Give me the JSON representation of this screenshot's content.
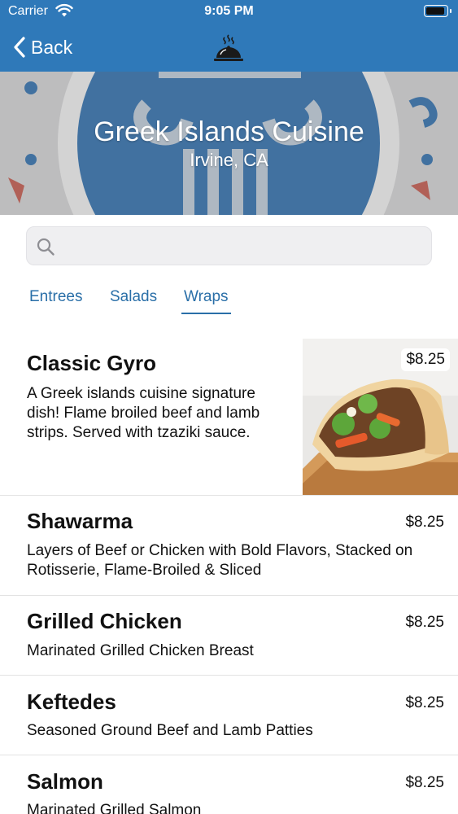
{
  "status_bar": {
    "carrier": "Carrier",
    "time": "9:05 PM",
    "battery_level": 0.95
  },
  "nav": {
    "back_label": "Back",
    "logo_icon": "cloche-icon"
  },
  "hero": {
    "title": "Greek Islands Cuisine",
    "subtitle": "Irvine, CA"
  },
  "search": {
    "placeholder": "",
    "value": ""
  },
  "tabs": [
    {
      "label": "Entrees",
      "active": false
    },
    {
      "label": "Salads",
      "active": false
    },
    {
      "label": "Wraps",
      "active": true
    }
  ],
  "menu_items": [
    {
      "name": "Classic Gyro",
      "description": "A Greek islands cuisine signature dish! Flame broiled beef and lamb strips. Served with tzaziki sauce.",
      "price": "$8.25",
      "has_image": true
    },
    {
      "name": "Shawarma",
      "description": "Layers of Beef or Chicken with Bold Flavors, Stacked on Rotisserie, Flame-Broiled & Sliced",
      "price": "$8.25"
    },
    {
      "name": "Grilled Chicken",
      "description": "Marinated Grilled Chicken Breast",
      "price": "$8.25"
    },
    {
      "name": "Keftedes",
      "description": "Seasoned Ground Beef and Lamb Patties",
      "price": "$8.25"
    },
    {
      "name": "Salmon",
      "description": "Marinated Grilled Salmon",
      "price": "$8.25"
    }
  ],
  "colors": {
    "nav_blue": "#2f79b9",
    "tab_blue": "#2a6fa8",
    "hero_logo_blue": "#2f6fae"
  }
}
